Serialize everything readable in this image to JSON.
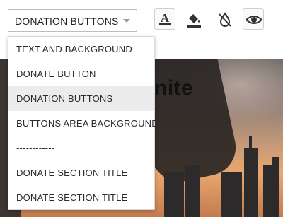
{
  "selector": {
    "value": "DONATION BUTTONS",
    "icon": "chevron-down-icon"
  },
  "toolbar": {
    "tools": [
      {
        "name": "text-color",
        "icon": "text-color-icon"
      },
      {
        "name": "fill-color",
        "icon": "paint-bucket-icon"
      },
      {
        "name": "no-fill",
        "icon": "no-drop-icon"
      },
      {
        "name": "visibility",
        "icon": "eye-icon"
      }
    ],
    "text_tool_glyph": "A"
  },
  "dropdown": {
    "options": [
      "TEXT AND BACKGROUND",
      "DONATE BUTTON",
      "DONATION BUTTONS",
      "BUTTONS AREA BACKGROUND",
      "------------",
      "DONATE SECTION TITLE",
      "DONATE SECTION TITLE"
    ],
    "selected_index": 2
  },
  "preview": {
    "title_fragment": "nite"
  },
  "colors": {
    "selected_option_bg": "#ececec",
    "border": "#bdbdbd",
    "text": "#222222"
  }
}
